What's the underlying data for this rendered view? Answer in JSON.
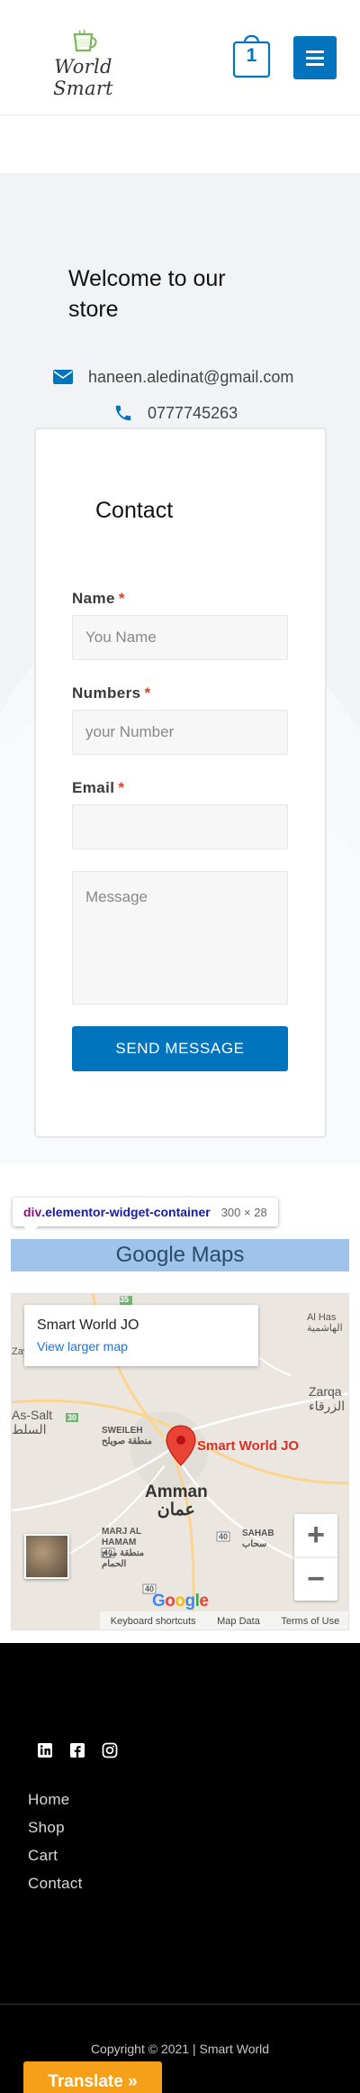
{
  "header": {
    "logo_text": "World Smart",
    "cart_count": "1"
  },
  "hero": {
    "welcome": "Welcome to our store",
    "email": "haneen.aledinat@gmail.com",
    "phone": "0777745263"
  },
  "form": {
    "title": "Contact",
    "name_label": "Name",
    "name_placeholder": "You Name",
    "numbers_label": "Numbers",
    "numbers_placeholder": "your Number",
    "email_label": "Email",
    "email_placeholder": "",
    "message_placeholder": "Message",
    "required_mark": "*",
    "send_label": "SEND MESSAGE"
  },
  "inspector": {
    "tag": "div",
    "class_name": ".elementor-widget-container",
    "dimensions": "300 × 28"
  },
  "maps": {
    "heading": "Google Maps",
    "place_title": "Smart World JO",
    "larger_map_link": "View larger map",
    "pin_label": "Smart World JO",
    "zoom_in": "+",
    "zoom_out": "−",
    "google": "Google",
    "footer_links": [
      "Keyboard shortcuts",
      "Map Data",
      "Terms of Use"
    ],
    "places": {
      "al_hash": "Al Has",
      "al_hash_ar": "الهاشمية",
      "zarqa": "Zarqa",
      "zarqa_ar": "الزرقاء",
      "as_salt": "As-Salt",
      "as_salt_ar": "السلط",
      "sweileh": "SWEILEH",
      "sweileh_ar": "منطقة صويلح",
      "amman": "Amman",
      "amman_ar": "عمان",
      "marj": "MARJ AL HAMAM",
      "marj_ar": "منطقة مرج الحمام",
      "sahab": "SAHAB",
      "sahab_ar": "سحاب",
      "zay": "Zay",
      "road_35": "35",
      "road_30": "30",
      "road_40a": "40",
      "road_40b": "40",
      "road_40c": "40"
    }
  },
  "footer": {
    "social_icons": [
      "linkedin-icon",
      "facebook-icon",
      "instagram-icon"
    ],
    "links": [
      "Home",
      "Shop",
      "Cart",
      "Contact"
    ],
    "copyright": "Copyright © 2021 | Smart World"
  },
  "translate": {
    "label": "Translate »"
  },
  "colors": {
    "primary": "#0274be",
    "required": "#e2401c",
    "translate": "#f6a019",
    "footer_bg": "#000000",
    "pin": "#d93025"
  }
}
